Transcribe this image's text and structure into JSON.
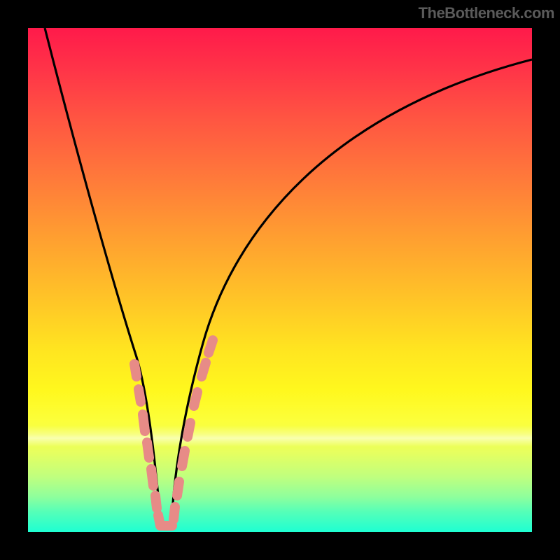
{
  "watermark": "TheBottleneck.com",
  "chart_data": {
    "type": "line",
    "title": "",
    "xlabel": "",
    "ylabel": "",
    "xlim": [
      0,
      100
    ],
    "ylim": [
      0,
      100
    ],
    "grid": false,
    "gradient": [
      "#ff1a4a",
      "#ff5542",
      "#ffa030",
      "#ffe520",
      "#fcff3a",
      "#8fff9c",
      "#1effd2"
    ],
    "series": [
      {
        "name": "curve",
        "x": [
          3,
          10,
          15,
          19,
          22,
          24,
          25,
          26,
          27,
          28,
          30,
          33,
          38,
          45,
          55,
          68,
          82,
          100
        ],
        "values": [
          100,
          72,
          54,
          38,
          22,
          10,
          3,
          0,
          0,
          3,
          12,
          26,
          44,
          60,
          74,
          84,
          90,
          94
        ]
      }
    ],
    "highlighted_regions": {
      "x_ranges_approx": [
        [
          19,
          25
        ],
        [
          27,
          34
        ]
      ],
      "color": "#e78b87",
      "description": "pink segmented strokes along both branches near trough"
    }
  }
}
